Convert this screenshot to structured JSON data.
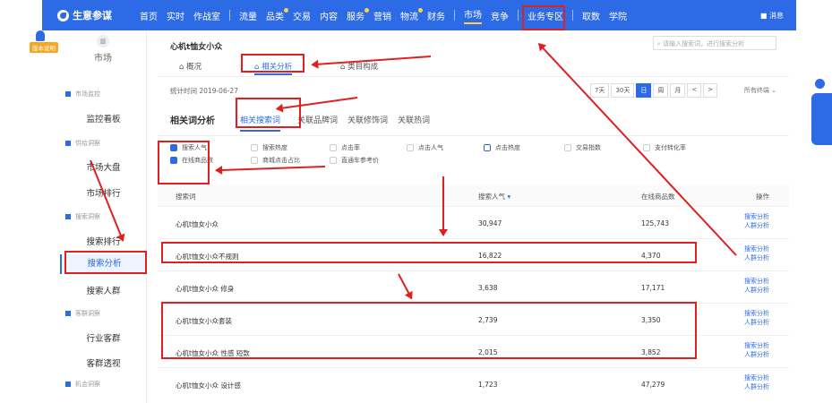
{
  "app": {
    "title": "生意参谋",
    "version": "版本说明",
    "message": "消息"
  },
  "nav": [
    {
      "label": "首页",
      "dot": false,
      "active": false
    },
    {
      "label": "实时",
      "dot": false,
      "active": false
    },
    {
      "label": "作战室",
      "dot": false,
      "active": false
    },
    {
      "label": "流量",
      "dot": false,
      "active": false
    },
    {
      "label": "品类",
      "dot": true,
      "active": false
    },
    {
      "label": "交易",
      "dot": false,
      "active": false
    },
    {
      "label": "内容",
      "dot": false,
      "active": false
    },
    {
      "label": "服务",
      "dot": true,
      "active": false
    },
    {
      "label": "营销",
      "dot": false,
      "active": false
    },
    {
      "label": "物流",
      "dot": true,
      "active": false
    },
    {
      "label": "财务",
      "dot": false,
      "active": false
    },
    {
      "label": "市场",
      "dot": false,
      "active": true
    },
    {
      "label": "竞争",
      "dot": false,
      "active": false
    },
    {
      "label": "业务专区",
      "dot": false,
      "active": false
    },
    {
      "label": "取数",
      "dot": false,
      "active": false
    },
    {
      "label": "学院",
      "dot": false,
      "active": false
    }
  ],
  "sidebar": {
    "section_title": "市场",
    "categories": [
      {
        "label": "市场监控"
      },
      {
        "label": "供给洞察"
      },
      {
        "label": "搜索洞察"
      },
      {
        "label": "客群洞察"
      },
      {
        "label": "机会洞察"
      }
    ],
    "items": [
      {
        "label": "监控看板"
      },
      {
        "label": "市场大盘"
      },
      {
        "label": "市场排行"
      },
      {
        "label": "搜索排行"
      },
      {
        "label": "搜索分析"
      },
      {
        "label": "搜索人群"
      },
      {
        "label": "行业客群"
      },
      {
        "label": "客群透视"
      }
    ]
  },
  "page": {
    "title": "心机t恤女小众",
    "search_placeholder": "请输入搜索词，进行搜索分析",
    "tabs": [
      {
        "label": "概况"
      },
      {
        "label": "相关分析"
      },
      {
        "label": "类目构成"
      }
    ],
    "stat_time": "统计时间 2019-06-27",
    "ranges": [
      "7天",
      "30天",
      "日",
      "周",
      "月",
      "<",
      ">"
    ],
    "device": "所有终端"
  },
  "analysis": {
    "title": "相关词分析",
    "tabs": [
      {
        "label": "相关搜索词"
      },
      {
        "label": "关联品牌词"
      },
      {
        "label": "关联修饰词"
      },
      {
        "label": "关联热词"
      }
    ]
  },
  "metrics": [
    {
      "label": "搜索人气",
      "checked": true
    },
    {
      "label": "搜索热度",
      "checked": false
    },
    {
      "label": "点击率",
      "checked": false
    },
    {
      "label": "点击人气",
      "checked": false
    },
    {
      "label": "点击热度",
      "checked": false
    },
    {
      "label": "交易指数",
      "checked": false
    },
    {
      "label": "支付转化率",
      "checked": false
    },
    {
      "label": "在线商品数",
      "checked": true
    },
    {
      "label": "商城点击占比",
      "checked": false
    },
    {
      "label": "直通车参考价",
      "checked": false
    }
  ],
  "table": {
    "headers": {
      "keyword": "搜索词",
      "popularity": "搜索人气",
      "products": "在线商品数",
      "actions": "操作"
    },
    "action_labels": {
      "search": "搜索分析",
      "crowd": "人群分析"
    },
    "rows": [
      {
        "keyword": "心机t恤女小众",
        "popularity": "30,947",
        "products": "125,743"
      },
      {
        "keyword": "心机t恤女小众不规则",
        "popularity": "16,822",
        "products": "4,370"
      },
      {
        "keyword": "心机t恤女小众 修身",
        "popularity": "3,638",
        "products": "17,171"
      },
      {
        "keyword": "心机t恤女小众套装",
        "popularity": "2,739",
        "products": "3,350"
      },
      {
        "keyword": "心机t恤女小众 性感 短款",
        "popularity": "2,015",
        "products": "3,852"
      },
      {
        "keyword": "心机t恤女小众 设计感",
        "popularity": "1,723",
        "products": "47,279"
      }
    ]
  },
  "colors": {
    "primary": "#2d6ae6",
    "annotation": "#e02020",
    "badge": "#f5a623"
  }
}
